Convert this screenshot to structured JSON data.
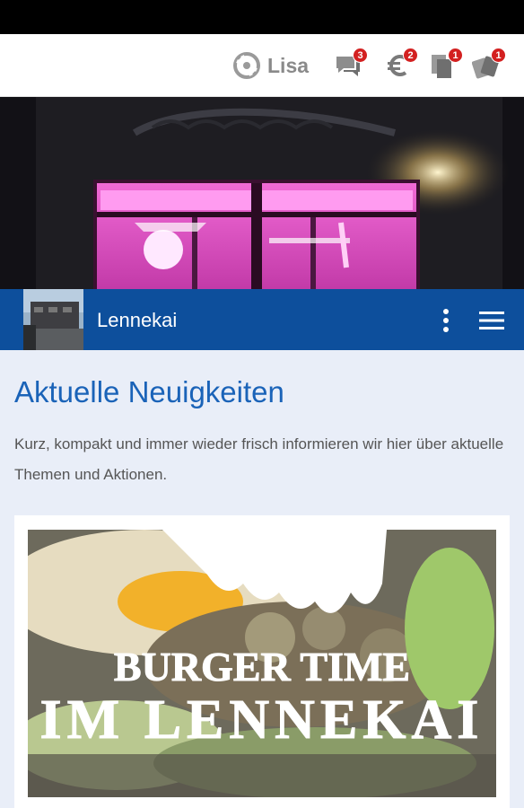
{
  "topbar": {
    "brand_name": "Lisa",
    "icons": [
      {
        "name": "chat-icon",
        "badge": "3"
      },
      {
        "name": "euro-icon",
        "badge": "2"
      },
      {
        "name": "coupon-icon",
        "badge": "1"
      },
      {
        "name": "stamp-card-icon",
        "badge": "1"
      }
    ]
  },
  "appbar": {
    "title": "Lennekai"
  },
  "content": {
    "heading": "Aktuelle Neuigkeiten",
    "description": "Kurz, kompakt und immer wieder frisch informieren wir hier über aktuelle Themen und Aktionen.",
    "news_image": {
      "line1": "BURGER TIME",
      "line2": "IM LENNEKAI"
    }
  },
  "colors": {
    "primary": "#0d4f9c",
    "heading": "#1a63b8",
    "badge": "#d32020",
    "background": "#e9eef8"
  }
}
